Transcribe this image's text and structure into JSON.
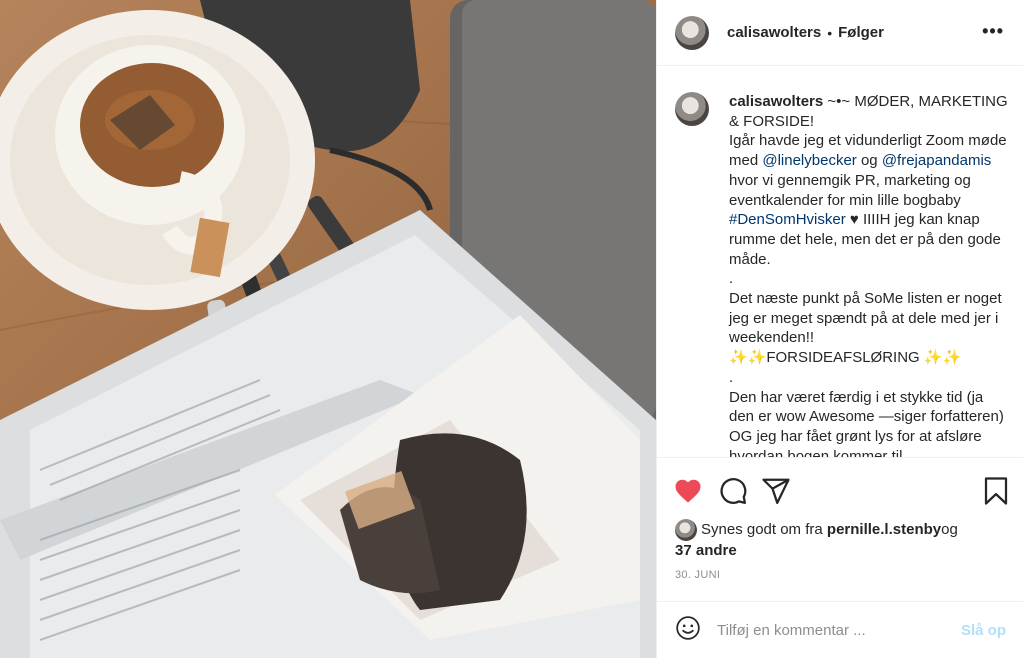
{
  "photo": {
    "alt_name": "post-photo"
  },
  "header": {
    "username": "calisawolters",
    "separator": "•",
    "follow_label": "Følger",
    "more_label": "•••"
  },
  "caption": {
    "username": "calisawolters",
    "line1": " ~•~ MØDER, MARKETING & FORSIDE!",
    "p1_a": "Igår havde jeg et vidunderligt Zoom møde med ",
    "mention1": "@linelybecker",
    "p1_b": " og ",
    "mention2": "@frejapandamis",
    "p1_c": " hvor vi gennemgik PR, marketing og eventkalender for min lille bogbaby ",
    "hashtag": "#DenSomHvisker",
    "p1_d": " ♥ IIIIH jeg kan knap rumme det hele, men det er på den gode måde.",
    "dot1": ".",
    "p2": "Det næste punkt på SoMe listen er noget jeg er meget spændt på at dele med jer i weekenden!!",
    "p3": "✨✨FORSIDEAFSLØRING ✨✨",
    "dot2": ".",
    "p4": "Den har været færdig i et stykke tid (ja den er wow Awesome —siger forfatteren) OG jeg har fået grønt lys for at afsløre hvordan bogen kommer til"
  },
  "actions": {
    "like_icon": "heart-filled-icon",
    "comment_icon": "comment-icon",
    "share_icon": "share-icon",
    "save_icon": "bookmark-icon",
    "like_color": "#ed4956"
  },
  "likes": {
    "prefix": "Synes godt om fra ",
    "user": "pernille.l.stenby",
    "mid": " og",
    "others": "37 andre"
  },
  "date": "30. JUNI",
  "comment": {
    "placeholder": "Tilføj en kommentar ...",
    "post_label": "Slå op"
  }
}
